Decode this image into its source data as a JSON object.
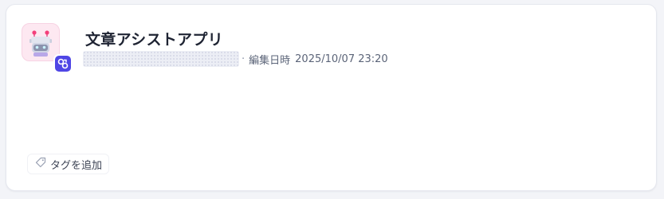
{
  "app": {
    "title": "文章アシストアプリ",
    "icon": "robot-icon",
    "badge_icon": "workflow-icon",
    "author": "",
    "separator": "·",
    "edited_label": "編集日時",
    "edited_at": "2025/10/07 23:20"
  },
  "tags": {
    "add_label": "タグを追加",
    "icon": "tag-icon"
  },
  "colors": {
    "badge": "#4f46e5",
    "icon_bg": "#fde8f1",
    "title_text": "#1f2433",
    "meta_text": "#5b6478"
  }
}
